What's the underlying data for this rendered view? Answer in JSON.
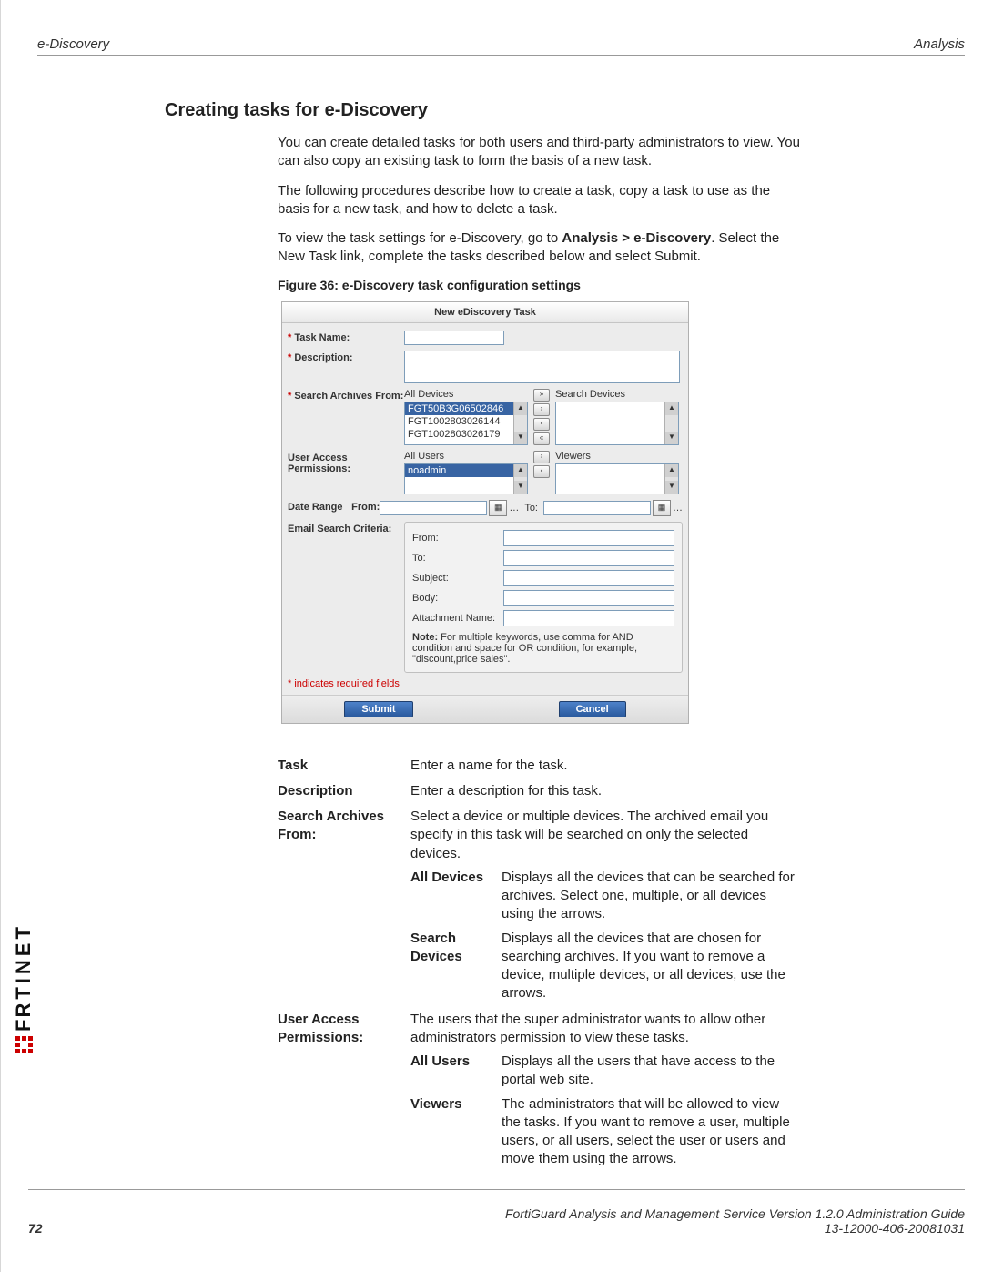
{
  "header": {
    "left": "e-Discovery",
    "right": "Analysis"
  },
  "heading": "Creating tasks for e-Discovery",
  "para1": "You can create detailed tasks for both users and third-party administrators to view. You can also copy an existing task to form the basis of a new task.",
  "para2": "The following procedures describe how to create a task, copy a task to use as the basis for a new task, and how to delete a task.",
  "para3_a": "To view the task settings for e-Discovery, go to ",
  "para3_b": "Analysis > e-Discovery",
  "para3_c": ". Select the New Task link, complete the tasks described below and select Submit.",
  "figcaption": "Figure 36: e-Discovery task configuration settings",
  "form": {
    "title": "New eDiscovery Task",
    "taskname_label": "Task Name:",
    "description_label": "Description:",
    "search_archives_label": "Search Archives From:",
    "all_devices": "All Devices",
    "search_devices": "Search Devices",
    "devices": [
      "FGT50B3G06502846",
      "FGT1002803026144",
      "FGT1002803026179"
    ],
    "uap_label": "User Access Permissions:",
    "all_users": "All Users",
    "viewers": "Viewers",
    "users": [
      "noadmin"
    ],
    "daterange_label": "Date Range",
    "from_label": "From:",
    "to_label": "To:",
    "esc_label": "Email Search Criteria:",
    "esc_from": "From:",
    "esc_to": "To:",
    "esc_subject": "Subject:",
    "esc_body": "Body:",
    "esc_attach": "Attachment Name:",
    "note_label": "Note:",
    "note_text": " For multiple keywords, use comma for AND condition and space for OR condition, for example, \"discount,price sales\".",
    "star": "*",
    "req_text": " indicates required fields",
    "submit": "Submit",
    "cancel": "Cancel"
  },
  "defs": {
    "task_t": "Task",
    "task_b": "Enter a name for the task.",
    "desc_t": "Description",
    "desc_b": "Enter a description for this task.",
    "saf_t": "Search Archives From:",
    "saf_b": "Select a device or multiple devices. The archived email you specify in this task will be searched on only the selected devices.",
    "alldev_t": "All Devices",
    "alldev_b": "Displays all the devices that can be searched for archives. Select one, multiple, or all devices using the arrows.",
    "sd_t": "Search Devices",
    "sd_b": "Displays all the devices that are chosen for searching archives. If you want to remove a device, multiple devices, or all devices, use the arrows.",
    "uap_t": "User Access Permissions:",
    "uap_b": "The users that the super administrator wants to allow other administrators permission to view these tasks.",
    "au_t": "All Users",
    "au_b": "Displays all the users that have access to the portal web site.",
    "v_t": "Viewers",
    "v_b": "The administrators that will be allowed to view the tasks. If you want to remove a user, multiple users, or all users, select the user or users and move them using the arrows."
  },
  "footer": {
    "line1": "FortiGuard Analysis and Management Service Version 1.2.0 Administration Guide",
    "line2": "13-12000-406-20081031",
    "pagenum": "72"
  },
  "logo_text": "RTINET"
}
